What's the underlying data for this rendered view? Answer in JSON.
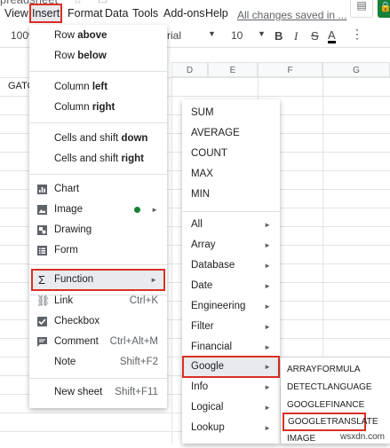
{
  "doc": {
    "title": "preadsheet"
  },
  "menubar": {
    "items": [
      "View",
      "Insert",
      "Format",
      "Data",
      "Tools",
      "Add-ons",
      "Help"
    ],
    "saved_text": "All changes saved in ..."
  },
  "toolbar": {
    "zoom": "100%",
    "font": "rial",
    "font_size": "10"
  },
  "sheet": {
    "columns": [
      "D",
      "E",
      "F",
      "G"
    ],
    "cell_text": "GATO"
  },
  "insert_menu": {
    "row_above_prefix": "Row ",
    "row_above_bold": "above",
    "row_below_prefix": "Row ",
    "row_below_bold": "below",
    "col_left_prefix": "Column ",
    "col_left_bold": "left",
    "col_right_prefix": "Column ",
    "col_right_bold": "right",
    "cells_down_prefix": "Cells and shift ",
    "cells_down_bold": "down",
    "cells_right_prefix": "Cells and shift ",
    "cells_right_bold": "right",
    "chart": "Chart",
    "image": "Image",
    "drawing": "Drawing",
    "form": "Form",
    "function": "Function",
    "link": "Link",
    "link_sc": "Ctrl+K",
    "checkbox": "Checkbox",
    "comment": "Comment",
    "comment_sc": "Ctrl+Alt+M",
    "note": "Note",
    "note_sc": "Shift+F2",
    "new_sheet": "New sheet",
    "new_sheet_sc": "Shift+F11"
  },
  "function_menu": {
    "items": [
      "SUM",
      "AVERAGE",
      "COUNT",
      "MAX",
      "MIN"
    ],
    "categories": [
      "All",
      "Array",
      "Database",
      "Date",
      "Engineering",
      "Filter",
      "Financial",
      "Google",
      "Info",
      "Logical",
      "Lookup"
    ]
  },
  "google_menu": {
    "items": [
      "ARRAYFORMULA",
      "DETECTLANGUAGE",
      "GOOGLEFINANCE",
      "GOOGLETRANSLATE",
      "IMAGE"
    ]
  },
  "watermark": "wsxdn.com",
  "colors": {
    "highlight": "#d93025",
    "sheets_green": "#188038"
  }
}
